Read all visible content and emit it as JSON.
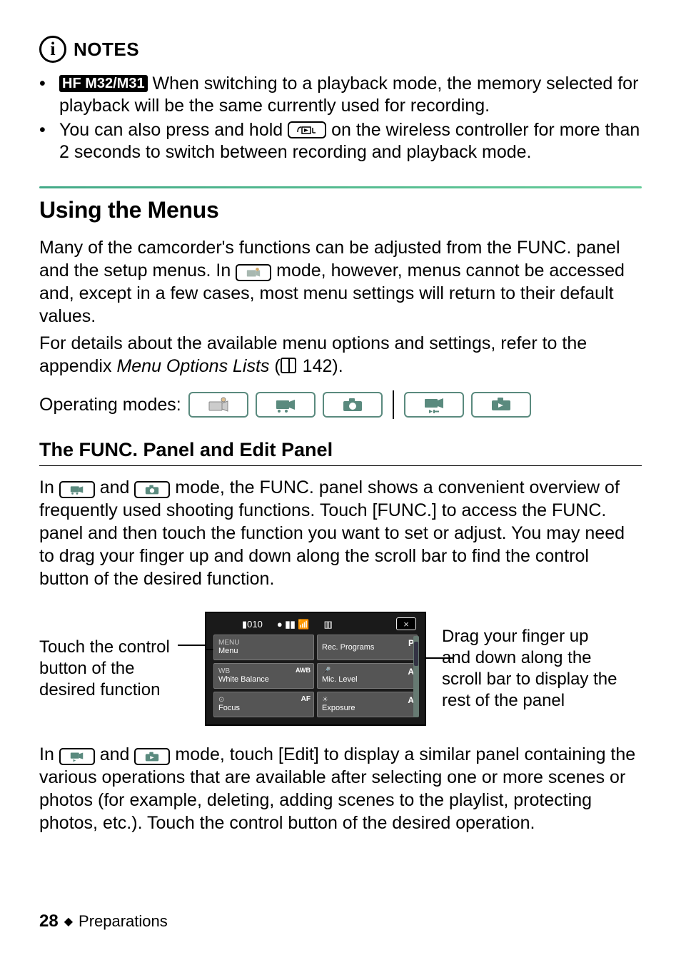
{
  "notes": {
    "title": "NOTES",
    "items": [
      {
        "badge": "HF M32/M31",
        "text_after_badge": " When switching to a playback mode, the memory selected for playback will be the same currently used for recording."
      },
      {
        "text_before_btn": "You can also press and hold ",
        "text_after_btn": " on the wireless controller for more than 2 seconds to switch between recording and playback mode."
      }
    ]
  },
  "section": {
    "heading": "Using the Menus",
    "para1_before_icon": "Many of the camcorder's functions can be adjusted from the FUNC. panel and the setup menus. In ",
    "para1_after_icon": " mode, however, menus cannot be accessed and, except in a few cases, most menu settings will return to their default values.",
    "para2_before_ref": "For details about the available menu options and settings, refer to the appendix ",
    "para2_ref_italic": "Menu Options Lists",
    "para2_after_ref": " (",
    "para2_page": " 142).",
    "op_modes_label": "Operating modes:"
  },
  "subsection": {
    "heading": "The FUNC. Panel and Edit Panel",
    "para1_a": "In ",
    "para1_b": " and ",
    "para1_c": " mode, the FUNC. panel shows a convenient overview of frequently used shooting functions. Touch [FUNC.] to access the FUNC. panel and then touch the function you want to set or adjust. You may need to drag your finger up and down along the scroll bar to find the control button of the desired function.",
    "fig_caption_left": "Touch the control button of the desired function",
    "fig_caption_right": "Drag your finger up and down along the scroll bar to display the rest of the panel",
    "para2_a": "In ",
    "para2_b": " and ",
    "para2_c": " mode, touch [Edit] to display a similar panel containing the various operations that are available after selecting one or more scenes or photos (for example, deleting, adding scenes to the playlist, protecting photos, etc.). Touch the control button of the desired operation."
  },
  "screenshot": {
    "counter": "010",
    "close": "×",
    "cells": [
      {
        "tl": "MENU",
        "bl": "Menu",
        "tr": ""
      },
      {
        "tl": "",
        "bl": "Rec. Programs",
        "tr": "P"
      },
      {
        "tl": "WB",
        "bl": "White Balance",
        "tr": "AWB"
      },
      {
        "tl": "🎤",
        "bl": "Mic. Level",
        "tr": "A"
      },
      {
        "tl": "⊙",
        "bl": "Focus",
        "tr": "AF"
      },
      {
        "tl": "☀",
        "bl": "Exposure",
        "tr": "A"
      }
    ]
  },
  "footer": {
    "page": "28",
    "chapter": "Preparations"
  },
  "icons": {
    "remote_btn": "remote-playback-icon"
  }
}
